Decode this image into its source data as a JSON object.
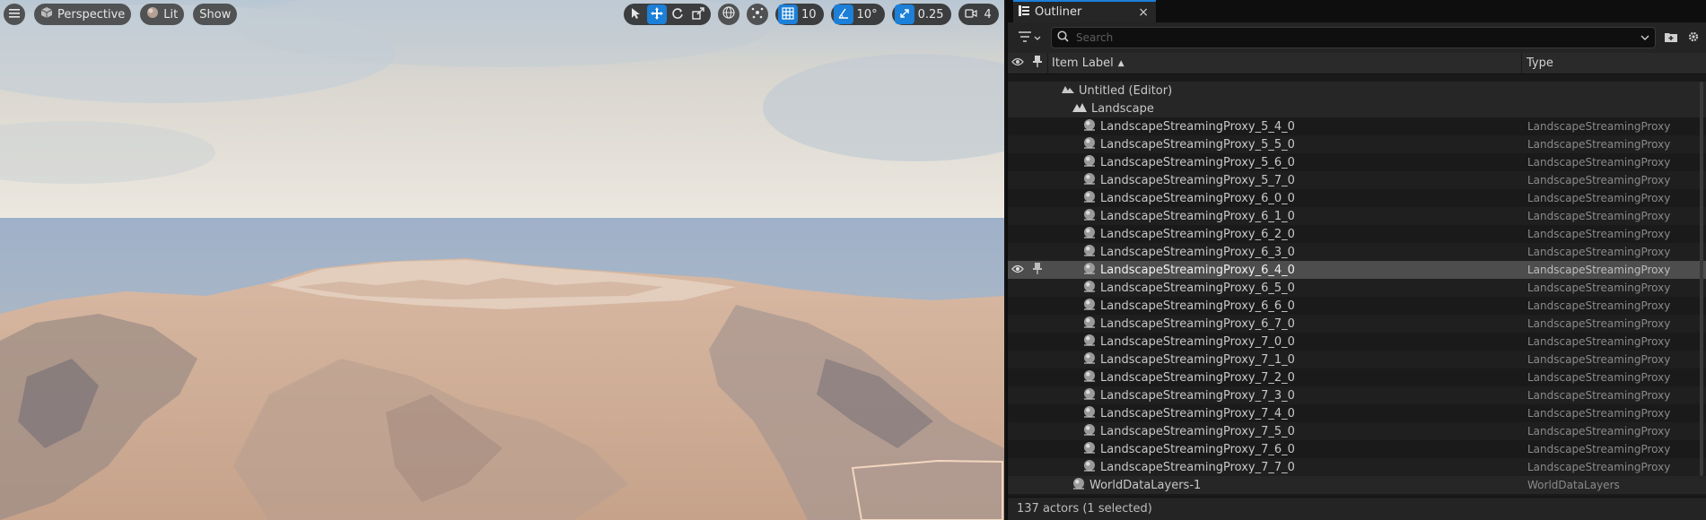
{
  "viewport": {
    "view_mode": "Perspective",
    "lighting_mode": "Lit",
    "show_label": "Show",
    "grid_snap_value": "10",
    "rotation_snap_value": "10°",
    "scale_snap_value": "0.25",
    "camera_speed_value": "4"
  },
  "outliner": {
    "tab_title": "Outliner",
    "close_glyph": "×",
    "search_placeholder": "Search",
    "columns": {
      "label": "Item Label",
      "sort_glyph": "▲",
      "type": "Type"
    },
    "world_label": "Untitled (Editor)",
    "folder_label": "Landscape",
    "proxies": [
      {
        "label": "LandscapeStreamingProxy_5_4_0",
        "type": "LandscapeStreamingProxy"
      },
      {
        "label": "LandscapeStreamingProxy_5_5_0",
        "type": "LandscapeStreamingProxy"
      },
      {
        "label": "LandscapeStreamingProxy_5_6_0",
        "type": "LandscapeStreamingProxy"
      },
      {
        "label": "LandscapeStreamingProxy_5_7_0",
        "type": "LandscapeStreamingProxy"
      },
      {
        "label": "LandscapeStreamingProxy_6_0_0",
        "type": "LandscapeStreamingProxy"
      },
      {
        "label": "LandscapeStreamingProxy_6_1_0",
        "type": "LandscapeStreamingProxy"
      },
      {
        "label": "LandscapeStreamingProxy_6_2_0",
        "type": "LandscapeStreamingProxy"
      },
      {
        "label": "LandscapeStreamingProxy_6_3_0",
        "type": "LandscapeStreamingProxy"
      },
      {
        "label": "LandscapeStreamingProxy_6_4_0",
        "type": "LandscapeStreamingProxy"
      },
      {
        "label": "LandscapeStreamingProxy_6_5_0",
        "type": "LandscapeStreamingProxy"
      },
      {
        "label": "LandscapeStreamingProxy_6_6_0",
        "type": "LandscapeStreamingProxy"
      },
      {
        "label": "LandscapeStreamingProxy_6_7_0",
        "type": "LandscapeStreamingProxy"
      },
      {
        "label": "LandscapeStreamingProxy_7_0_0",
        "type": "LandscapeStreamingProxy"
      },
      {
        "label": "LandscapeStreamingProxy_7_1_0",
        "type": "LandscapeStreamingProxy"
      },
      {
        "label": "LandscapeStreamingProxy_7_2_0",
        "type": "LandscapeStreamingProxy"
      },
      {
        "label": "LandscapeStreamingProxy_7_3_0",
        "type": "LandscapeStreamingProxy"
      },
      {
        "label": "LandscapeStreamingProxy_7_4_0",
        "type": "LandscapeStreamingProxy"
      },
      {
        "label": "LandscapeStreamingProxy_7_5_0",
        "type": "LandscapeStreamingProxy"
      },
      {
        "label": "LandscapeStreamingProxy_7_6_0",
        "type": "LandscapeStreamingProxy"
      },
      {
        "label": "LandscapeStreamingProxy_7_7_0",
        "type": "LandscapeStreamingProxy"
      }
    ],
    "world_data_layers": {
      "label": "WorldDataLayers-1",
      "type": "WorldDataLayers"
    },
    "status": "137 actors (1 selected)"
  },
  "colors": {
    "accent": "#1c7fd8",
    "selected_row": "#4d4d4d",
    "panel_bg": "#1a1a1a"
  }
}
